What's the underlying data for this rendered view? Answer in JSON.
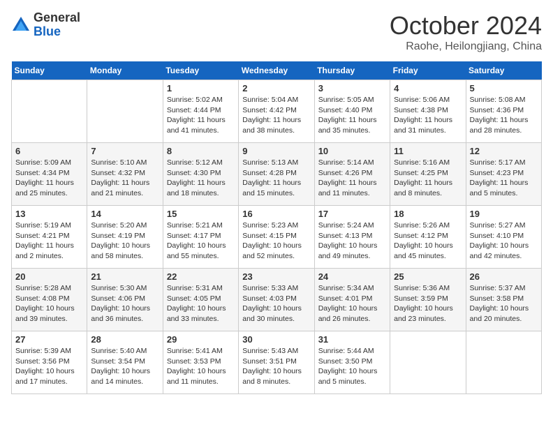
{
  "header": {
    "logo_general": "General",
    "logo_blue": "Blue",
    "month": "October 2024",
    "location": "Raohe, Heilongjiang, China"
  },
  "days_of_week": [
    "Sunday",
    "Monday",
    "Tuesday",
    "Wednesday",
    "Thursday",
    "Friday",
    "Saturday"
  ],
  "weeks": [
    [
      {
        "day": "",
        "content": ""
      },
      {
        "day": "",
        "content": ""
      },
      {
        "day": "1",
        "content": "Sunrise: 5:02 AM\nSunset: 4:44 PM\nDaylight: 11 hours and 41 minutes."
      },
      {
        "day": "2",
        "content": "Sunrise: 5:04 AM\nSunset: 4:42 PM\nDaylight: 11 hours and 38 minutes."
      },
      {
        "day": "3",
        "content": "Sunrise: 5:05 AM\nSunset: 4:40 PM\nDaylight: 11 hours and 35 minutes."
      },
      {
        "day": "4",
        "content": "Sunrise: 5:06 AM\nSunset: 4:38 PM\nDaylight: 11 hours and 31 minutes."
      },
      {
        "day": "5",
        "content": "Sunrise: 5:08 AM\nSunset: 4:36 PM\nDaylight: 11 hours and 28 minutes."
      }
    ],
    [
      {
        "day": "6",
        "content": "Sunrise: 5:09 AM\nSunset: 4:34 PM\nDaylight: 11 hours and 25 minutes."
      },
      {
        "day": "7",
        "content": "Sunrise: 5:10 AM\nSunset: 4:32 PM\nDaylight: 11 hours and 21 minutes."
      },
      {
        "day": "8",
        "content": "Sunrise: 5:12 AM\nSunset: 4:30 PM\nDaylight: 11 hours and 18 minutes."
      },
      {
        "day": "9",
        "content": "Sunrise: 5:13 AM\nSunset: 4:28 PM\nDaylight: 11 hours and 15 minutes."
      },
      {
        "day": "10",
        "content": "Sunrise: 5:14 AM\nSunset: 4:26 PM\nDaylight: 11 hours and 11 minutes."
      },
      {
        "day": "11",
        "content": "Sunrise: 5:16 AM\nSunset: 4:25 PM\nDaylight: 11 hours and 8 minutes."
      },
      {
        "day": "12",
        "content": "Sunrise: 5:17 AM\nSunset: 4:23 PM\nDaylight: 11 hours and 5 minutes."
      }
    ],
    [
      {
        "day": "13",
        "content": "Sunrise: 5:19 AM\nSunset: 4:21 PM\nDaylight: 11 hours and 2 minutes."
      },
      {
        "day": "14",
        "content": "Sunrise: 5:20 AM\nSunset: 4:19 PM\nDaylight: 10 hours and 58 minutes."
      },
      {
        "day": "15",
        "content": "Sunrise: 5:21 AM\nSunset: 4:17 PM\nDaylight: 10 hours and 55 minutes."
      },
      {
        "day": "16",
        "content": "Sunrise: 5:23 AM\nSunset: 4:15 PM\nDaylight: 10 hours and 52 minutes."
      },
      {
        "day": "17",
        "content": "Sunrise: 5:24 AM\nSunset: 4:13 PM\nDaylight: 10 hours and 49 minutes."
      },
      {
        "day": "18",
        "content": "Sunrise: 5:26 AM\nSunset: 4:12 PM\nDaylight: 10 hours and 45 minutes."
      },
      {
        "day": "19",
        "content": "Sunrise: 5:27 AM\nSunset: 4:10 PM\nDaylight: 10 hours and 42 minutes."
      }
    ],
    [
      {
        "day": "20",
        "content": "Sunrise: 5:28 AM\nSunset: 4:08 PM\nDaylight: 10 hours and 39 minutes."
      },
      {
        "day": "21",
        "content": "Sunrise: 5:30 AM\nSunset: 4:06 PM\nDaylight: 10 hours and 36 minutes."
      },
      {
        "day": "22",
        "content": "Sunrise: 5:31 AM\nSunset: 4:05 PM\nDaylight: 10 hours and 33 minutes."
      },
      {
        "day": "23",
        "content": "Sunrise: 5:33 AM\nSunset: 4:03 PM\nDaylight: 10 hours and 30 minutes."
      },
      {
        "day": "24",
        "content": "Sunrise: 5:34 AM\nSunset: 4:01 PM\nDaylight: 10 hours and 26 minutes."
      },
      {
        "day": "25",
        "content": "Sunrise: 5:36 AM\nSunset: 3:59 PM\nDaylight: 10 hours and 23 minutes."
      },
      {
        "day": "26",
        "content": "Sunrise: 5:37 AM\nSunset: 3:58 PM\nDaylight: 10 hours and 20 minutes."
      }
    ],
    [
      {
        "day": "27",
        "content": "Sunrise: 5:39 AM\nSunset: 3:56 PM\nDaylight: 10 hours and 17 minutes."
      },
      {
        "day": "28",
        "content": "Sunrise: 5:40 AM\nSunset: 3:54 PM\nDaylight: 10 hours and 14 minutes."
      },
      {
        "day": "29",
        "content": "Sunrise: 5:41 AM\nSunset: 3:53 PM\nDaylight: 10 hours and 11 minutes."
      },
      {
        "day": "30",
        "content": "Sunrise: 5:43 AM\nSunset: 3:51 PM\nDaylight: 10 hours and 8 minutes."
      },
      {
        "day": "31",
        "content": "Sunrise: 5:44 AM\nSunset: 3:50 PM\nDaylight: 10 hours and 5 minutes."
      },
      {
        "day": "",
        "content": ""
      },
      {
        "day": "",
        "content": ""
      }
    ]
  ]
}
